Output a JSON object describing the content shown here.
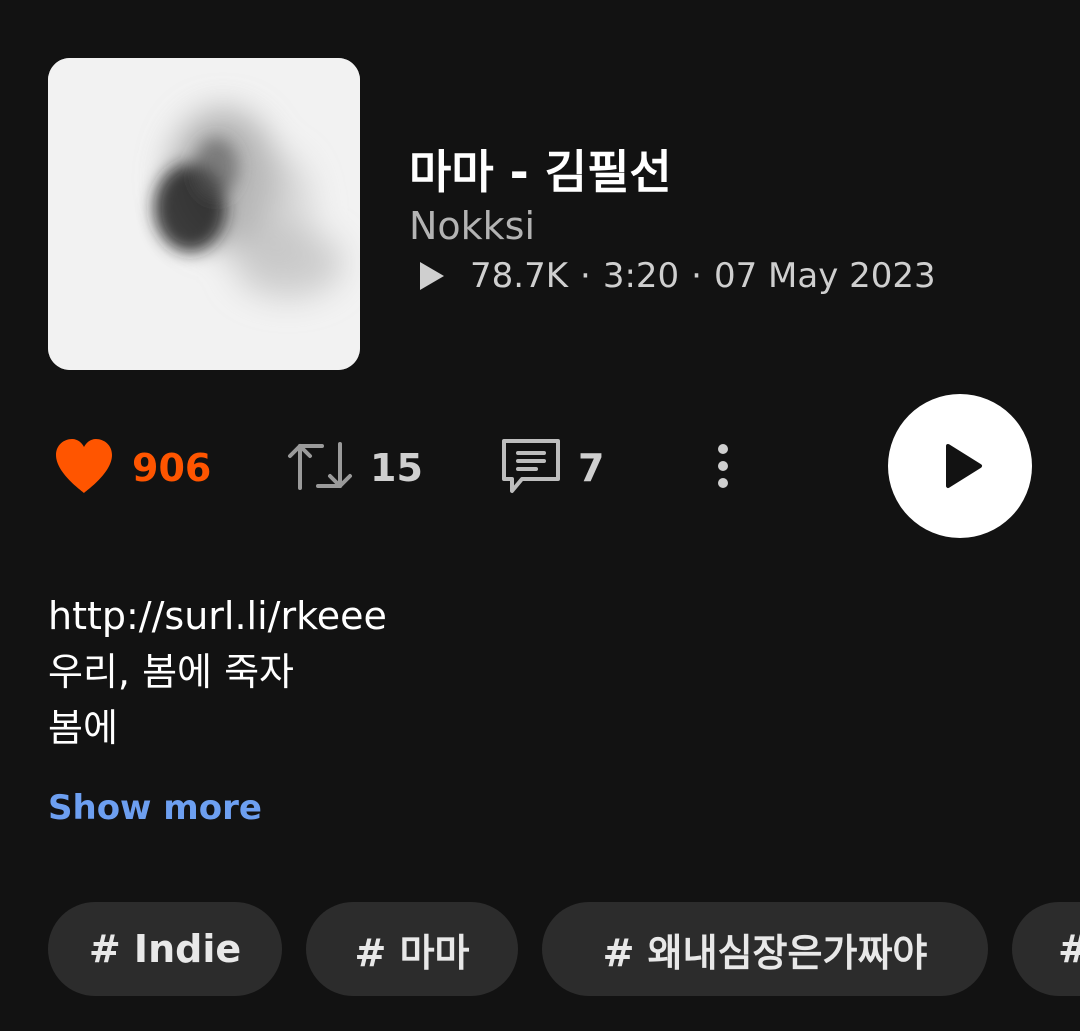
{
  "track": {
    "title": "마마 - 김필선",
    "artist": "Nokksi",
    "plays": "78.7K",
    "duration": "3:20",
    "date": "07 May 2023",
    "separator": "·"
  },
  "actions": {
    "likes": "906",
    "reposts": "15",
    "comments": "7",
    "like_icon": "heart-icon",
    "repost_icon": "repost-icon",
    "comment_icon": "comment-icon",
    "more_icon": "more-vertical-icon",
    "play_icon": "play-icon"
  },
  "description": {
    "lines": [
      "http://surl.li/rkeee",
      "우리, 봄에 죽자",
      "봄에"
    ],
    "show_more": "Show more"
  },
  "tags": [
    "# Indie",
    "# 마마",
    "# 왜내심장은가짜야",
    "#"
  ],
  "colors": {
    "background": "#121212",
    "accent": "#ff5500",
    "link": "#6d9ff0",
    "tag_background": "#2c2c2c"
  }
}
